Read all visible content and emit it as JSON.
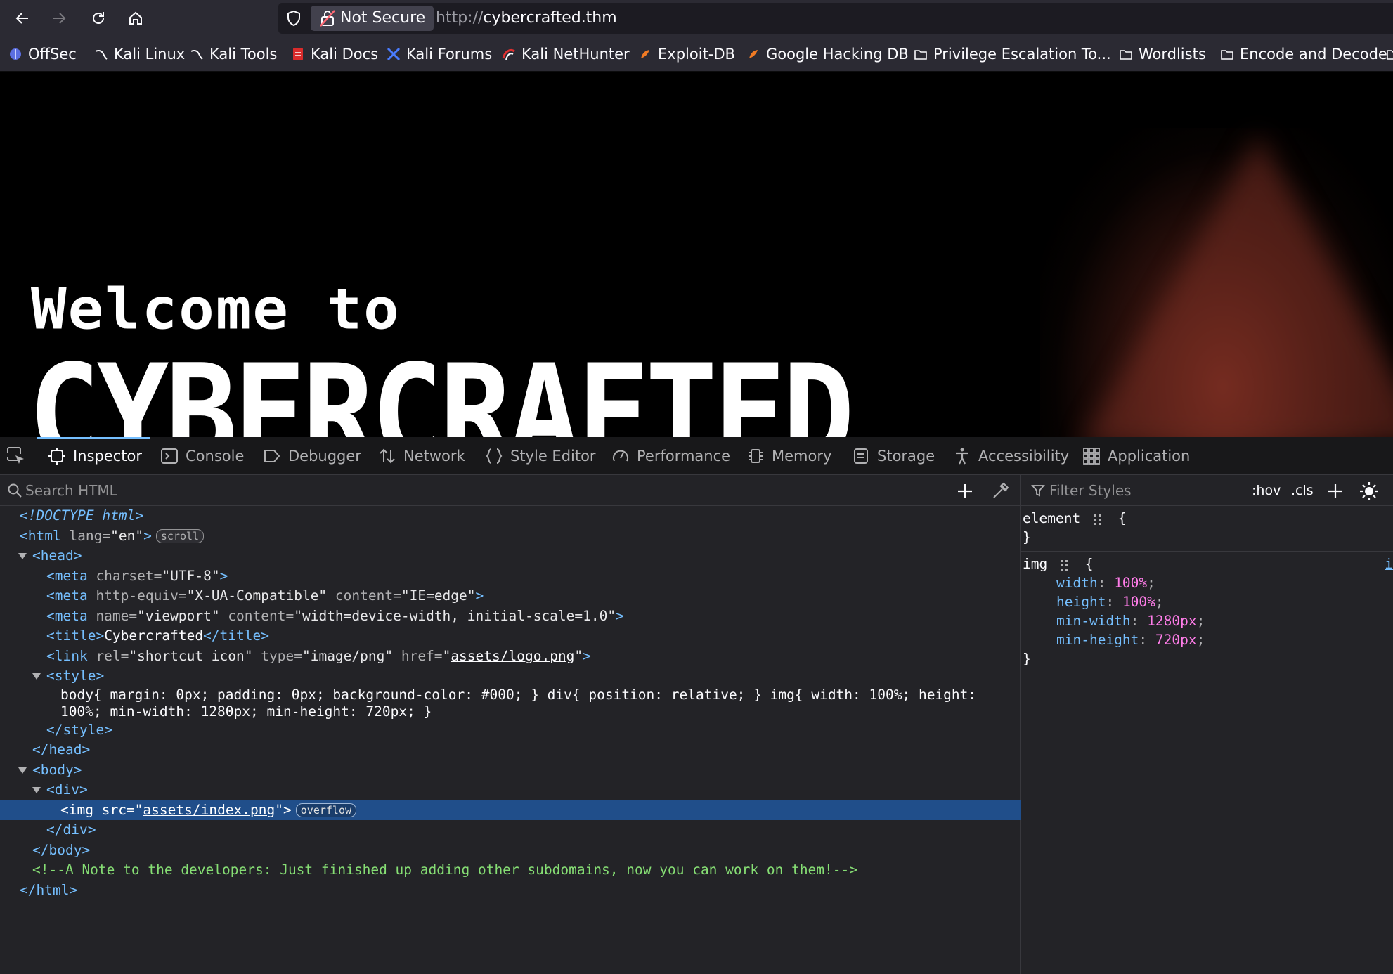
{
  "browser": {
    "back_icon": "arrow-left-icon",
    "forward_icon": "arrow-right-icon",
    "reload_icon": "reload-icon",
    "home_icon": "home-icon",
    "security_label": "Not Secure",
    "url_scheme": "http://",
    "url_host": "cybercrafted.thm"
  },
  "bookmarks": [
    {
      "label": "OffSec",
      "icon": "offsec-icon"
    },
    {
      "label": "Kali Linux",
      "icon": "kali-dragon-icon"
    },
    {
      "label": "Kali Tools",
      "icon": "kali-dragon-icon"
    },
    {
      "label": "Kali Docs",
      "icon": "kali-docs-icon"
    },
    {
      "label": "Kali Forums",
      "icon": "kali-forums-icon"
    },
    {
      "label": "Kali NetHunter",
      "icon": "nethunter-icon"
    },
    {
      "label": "Exploit-DB",
      "icon": "exploitdb-icon"
    },
    {
      "label": "Google Hacking DB",
      "icon": "ghdb-icon"
    },
    {
      "label": "Privilege Escalation To...",
      "icon": "folder-icon"
    },
    {
      "label": "Wordlists",
      "icon": "folder-icon"
    },
    {
      "label": "Encode and Decode",
      "icon": "folder-icon"
    }
  ],
  "page": {
    "welcome": "Welcome to",
    "logo": "CYBERCRAFTED"
  },
  "devtools": {
    "tabs": [
      {
        "label": "Inspector",
        "icon": "inspector-icon",
        "selected": true
      },
      {
        "label": "Console",
        "icon": "console-icon"
      },
      {
        "label": "Debugger",
        "icon": "debugger-icon"
      },
      {
        "label": "Network",
        "icon": "network-icon"
      },
      {
        "label": "Style Editor",
        "icon": "style-editor-icon"
      },
      {
        "label": "Performance",
        "icon": "performance-icon"
      },
      {
        "label": "Memory",
        "icon": "memory-icon"
      },
      {
        "label": "Storage",
        "icon": "storage-icon"
      },
      {
        "label": "Accessibility",
        "icon": "accessibility-icon"
      },
      {
        "label": "Application",
        "icon": "application-icon"
      }
    ],
    "search_placeholder": "Search HTML",
    "filter_placeholder": "Filter Styles",
    "hov_label": ":hov",
    "cls_label": ".cls",
    "markup": {
      "doctype": "<!DOCTYPE html>",
      "html_open_tag": "<html",
      "html_attr": " lang=",
      "html_val": "\"en\"",
      "html_close": ">",
      "scroll_badge": "scroll",
      "head_open": "<head>",
      "meta1_tag": "<meta",
      "meta1_attr": " charset=",
      "meta1_val": "\"UTF-8\"",
      "meta2_tag": "<meta",
      "meta2_attr1": " http-equiv=",
      "meta2_val1": "\"X-UA-Compatible\"",
      "meta2_attr2": " content=",
      "meta2_val2": "\"IE=edge\"",
      "meta3_tag": "<meta",
      "meta3_attr1": " name=",
      "meta3_val1": "\"viewport\"",
      "meta3_attr2": " content=",
      "meta3_val2": "\"width=device-width, initial-scale=1.0\"",
      "title_open": "<title>",
      "title_text": "Cybercrafted",
      "title_close": "</title>",
      "link_tag": "<link",
      "link_attr1": " rel=",
      "link_val1": "\"shortcut icon\"",
      "link_attr2": " type=",
      "link_val2": "\"image/png\"",
      "link_attr3": " href=",
      "link_href": "assets/logo.png",
      "style_open": "<style>",
      "style_text_1": "body{ margin: 0px; padding: 0px; background-color: #000; } div{ position: relative; } img{ width: 100%; height:",
      "style_text_2": "100%; min-width: 1280px; min-height: 720px; }",
      "style_close": "</style>",
      "head_close": "</head>",
      "body_open": "<body>",
      "div_open": "<div>",
      "img_tag": "<img",
      "img_attr": " src=",
      "img_src": "assets/index.png",
      "overflow_badge": "overflow",
      "div_close": "</div>",
      "body_close": "</body>",
      "comment": "<!--A Note to the developers: Just finished up adding other subdomains, now you can work on them!-->",
      "html_close_tag": "</html>"
    },
    "rules": {
      "element_selector": "element",
      "img_selector": "img",
      "source_link": "i",
      "declarations": [
        {
          "prop": "width",
          "value": "100%"
        },
        {
          "prop": "height",
          "value": "100%"
        },
        {
          "prop": "min-width",
          "value": "1280px"
        },
        {
          "prop": "min-height",
          "value": "720px"
        }
      ]
    }
  }
}
